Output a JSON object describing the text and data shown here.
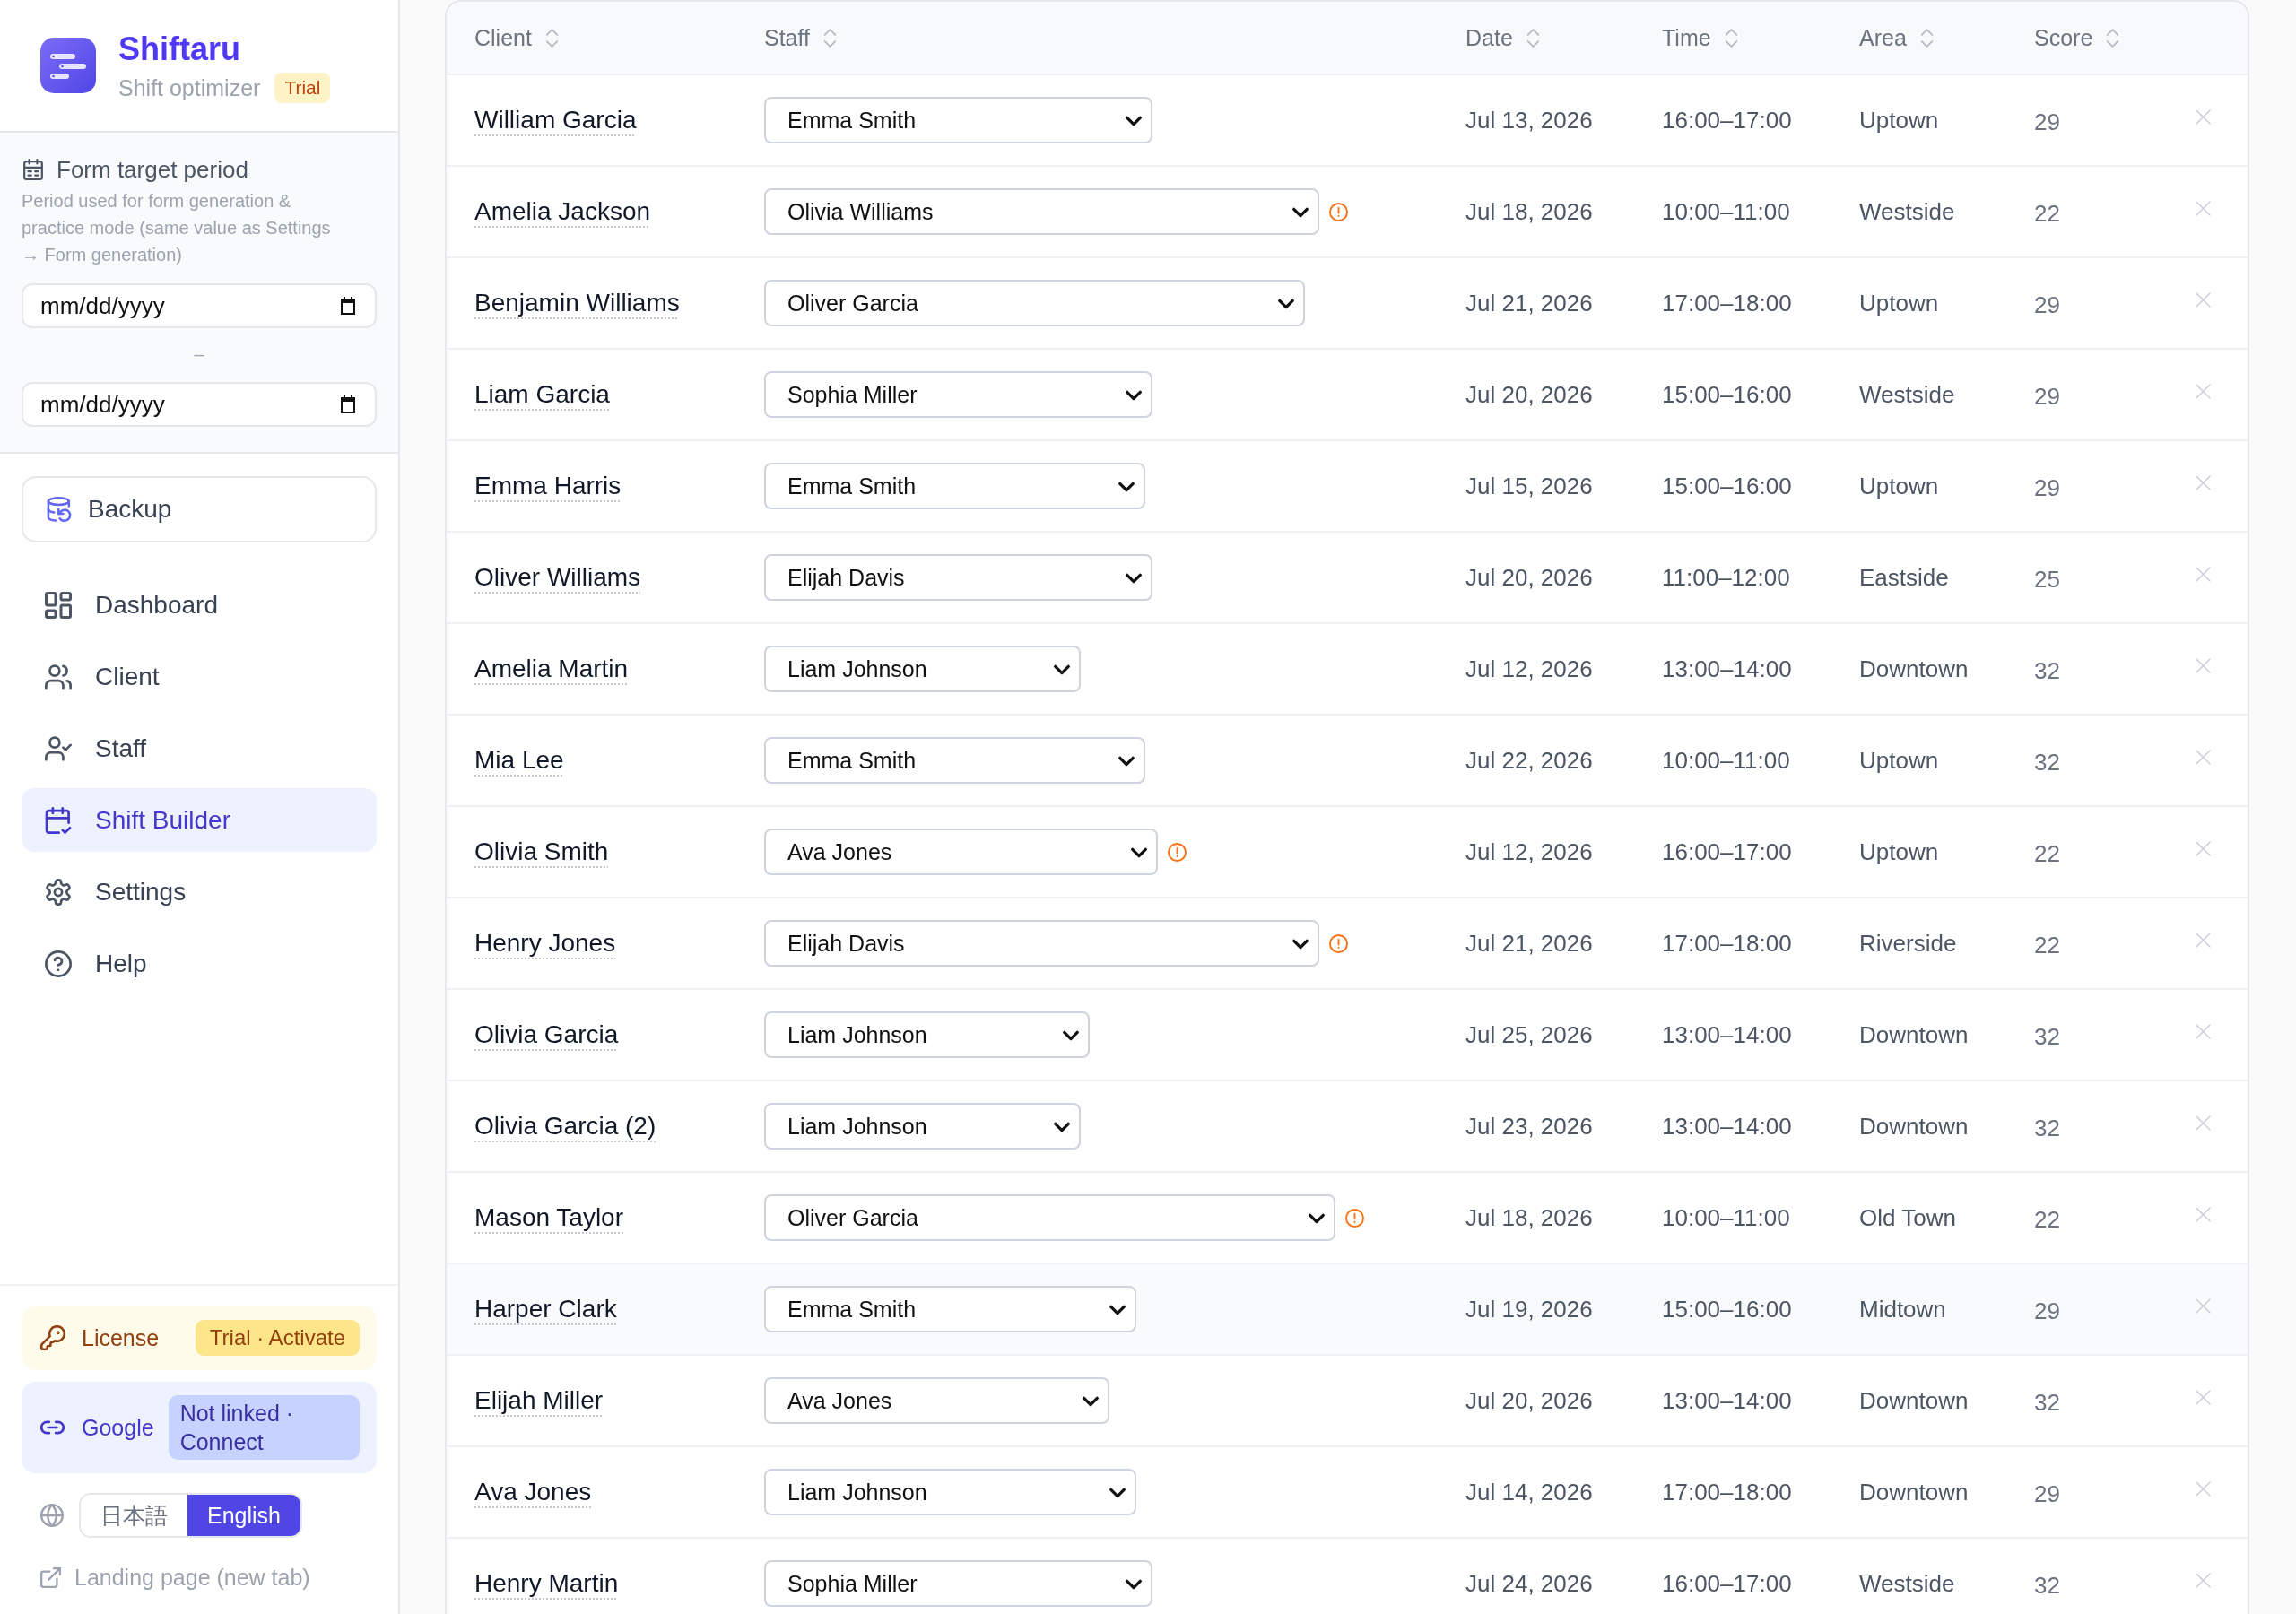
{
  "brand": {
    "name": "Shiftaru",
    "tagline": "Shift optimizer",
    "badge": "Trial"
  },
  "period": {
    "title": "Form target period",
    "description": "Period used for form generation & practice mode (same value as Settings → Form generation)",
    "start": {
      "placeholder": "mm/dd/yyyy"
    },
    "separator": "–",
    "end": {
      "placeholder": "mm/dd/yyyy"
    }
  },
  "backup_button": "Backup",
  "nav": [
    {
      "label": "Dashboard",
      "selected": false
    },
    {
      "label": "Client",
      "selected": false
    },
    {
      "label": "Staff",
      "selected": false
    },
    {
      "label": "Shift Builder",
      "selected": true
    },
    {
      "label": "Settings",
      "selected": false
    },
    {
      "label": "Help",
      "selected": false
    }
  ],
  "license": {
    "label": "License",
    "badge": "Trial · Activate"
  },
  "google": {
    "label": "Google",
    "badge": "Not linked · Connect"
  },
  "languages": [
    {
      "label": "日本語",
      "selected": false
    },
    {
      "label": "English",
      "selected": true
    }
  ],
  "landing_link": "Landing page (new tab)",
  "table": {
    "columns": [
      "Client",
      "Staff",
      "Date",
      "Time",
      "Area",
      "Score"
    ],
    "rows": [
      {
        "client": "William Garcia",
        "staff": "Emma Smith",
        "warning": false,
        "date": "Jul 13, 2026",
        "time": "16:00–17:00",
        "area": "Uptown",
        "score": "29",
        "highlighted": false
      },
      {
        "client": "Amelia Jackson",
        "staff": "Olivia Williams",
        "warning": true,
        "date": "Jul 18, 2026",
        "time": "10:00–11:00",
        "area": "Westside",
        "score": "22",
        "highlighted": false
      },
      {
        "client": "Benjamin Williams",
        "staff": "Oliver Garcia",
        "warning": false,
        "date": "Jul 21, 2026",
        "time": "17:00–18:00",
        "area": "Uptown",
        "score": "29",
        "highlighted": false
      },
      {
        "client": "Liam Garcia",
        "staff": "Sophia Miller",
        "warning": false,
        "date": "Jul 20, 2026",
        "time": "15:00–16:00",
        "area": "Westside",
        "score": "29",
        "highlighted": false
      },
      {
        "client": "Emma Harris",
        "staff": "Emma Smith",
        "warning": false,
        "date": "Jul 15, 2026",
        "time": "15:00–16:00",
        "area": "Uptown",
        "score": "29",
        "highlighted": false
      },
      {
        "client": "Oliver Williams",
        "staff": "Elijah Davis",
        "warning": false,
        "date": "Jul 20, 2026",
        "time": "11:00–12:00",
        "area": "Eastside",
        "score": "25",
        "highlighted": false
      },
      {
        "client": "Amelia Martin",
        "staff": "Liam Johnson",
        "warning": false,
        "date": "Jul 12, 2026",
        "time": "13:00–14:00",
        "area": "Downtown",
        "score": "32",
        "highlighted": false
      },
      {
        "client": "Mia Lee",
        "staff": "Emma Smith",
        "warning": false,
        "date": "Jul 22, 2026",
        "time": "10:00–11:00",
        "area": "Uptown",
        "score": "32",
        "highlighted": false
      },
      {
        "client": "Olivia Smith",
        "staff": "Ava Jones",
        "warning": true,
        "date": "Jul 12, 2026",
        "time": "16:00–17:00",
        "area": "Uptown",
        "score": "22",
        "highlighted": false
      },
      {
        "client": "Henry Jones",
        "staff": "Elijah Davis",
        "warning": true,
        "date": "Jul 21, 2026",
        "time": "17:00–18:00",
        "area": "Riverside",
        "score": "22",
        "highlighted": false
      },
      {
        "client": "Olivia Garcia",
        "staff": "Liam Johnson",
        "warning": false,
        "date": "Jul 25, 2026",
        "time": "13:00–14:00",
        "area": "Downtown",
        "score": "32",
        "highlighted": false
      },
      {
        "client": "Olivia Garcia (2)",
        "staff": "Liam Johnson",
        "warning": false,
        "date": "Jul 23, 2026",
        "time": "13:00–14:00",
        "area": "Downtown",
        "score": "32",
        "highlighted": false
      },
      {
        "client": "Mason Taylor",
        "staff": "Oliver Garcia",
        "warning": true,
        "date": "Jul 18, 2026",
        "time": "10:00–11:00",
        "area": "Old Town",
        "score": "22",
        "highlighted": false
      },
      {
        "client": "Harper Clark",
        "staff": "Emma Smith",
        "warning": false,
        "date": "Jul 19, 2026",
        "time": "15:00–16:00",
        "area": "Midtown",
        "score": "29",
        "highlighted": true
      },
      {
        "client": "Elijah Miller",
        "staff": "Ava Jones",
        "warning": false,
        "date": "Jul 20, 2026",
        "time": "13:00–14:00",
        "area": "Downtown",
        "score": "32",
        "highlighted": false
      },
      {
        "client": "Ava Jones",
        "staff": "Liam Johnson",
        "warning": false,
        "date": "Jul 14, 2026",
        "time": "17:00–18:00",
        "area": "Downtown",
        "score": "29",
        "highlighted": false
      },
      {
        "client": "Henry Martin",
        "staff": "Sophia Miller",
        "warning": false,
        "date": "Jul 24, 2026",
        "time": "16:00–17:00",
        "area": "Westside",
        "score": "32",
        "highlighted": false
      }
    ]
  }
}
